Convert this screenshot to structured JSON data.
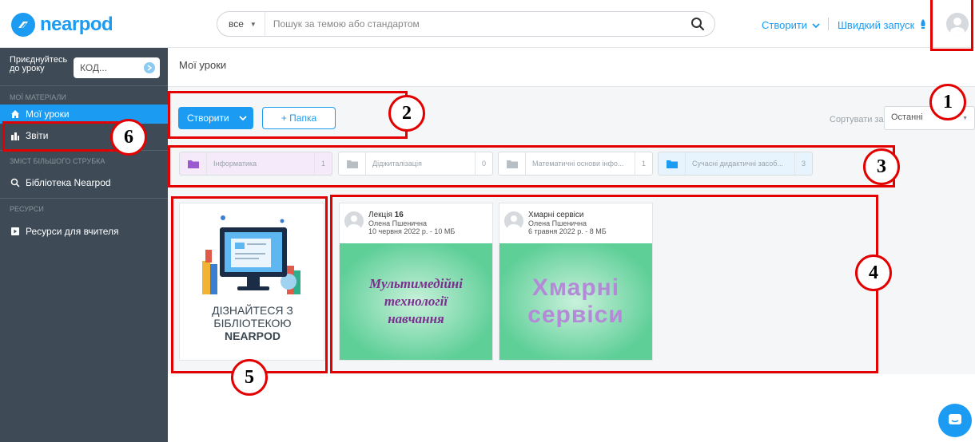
{
  "brand": {
    "name": "nearpod",
    "color": "#1b9cf2"
  },
  "search": {
    "scope": "все",
    "placeholder": "Пошук за темою або стандартом"
  },
  "header": {
    "create": "Створити",
    "quick_launch": "Швидкий запуск"
  },
  "sidebar": {
    "join_label": "Приєднуйтесь до уроку",
    "join_placeholder": "КОД...",
    "section_my": "МОЇ МАТЕРІАЛИ",
    "item_lessons": "Мої уроки",
    "item_reports": "Звіти",
    "section_content": "ЗМІСТ БІЛЬШОГО СТРУБКА",
    "item_library": "Бібліотека Nearpod",
    "section_resources": "РЕСУРСИ",
    "item_resources": "Ресурси для вчителя"
  },
  "main": {
    "title": "Мої уроки",
    "create_button": "Створити",
    "folder_button": "+ Папка",
    "sort_label": "Сортувати за:",
    "sort_value": "Останні"
  },
  "folders": [
    {
      "name": "Інформатика",
      "count": "1",
      "color": "#9b59d0",
      "bg": "#f4eafa"
    },
    {
      "name": "Діджиталізація",
      "count": "0",
      "color": "#b7bec4",
      "bg": "#ffffff"
    },
    {
      "name": "Математичні основи інфо...",
      "count": "1",
      "color": "#b7bec4",
      "bg": "#ffffff"
    },
    {
      "name": "Сучасні дидактичні засоб...",
      "count": "3",
      "color": "#1b9cf2",
      "bg": "#e8f4fd"
    }
  ],
  "promo": {
    "line1": "ДІЗНАЙТЕСЯ З",
    "line2": "БІБЛІОТЕКОЮ",
    "line3": "NEARPOD"
  },
  "cards": [
    {
      "title_prefix": "Лекція ",
      "title_number": "16",
      "author": "Олена Пшенична",
      "meta": "10 червня 2022 р. - 10 МБ",
      "thumb_line1": "Мультимедійні",
      "thumb_line2": "технології",
      "thumb_line3": "навчання"
    },
    {
      "title": "Хмарні сервіси",
      "author": "Олена Пшенична",
      "meta": "6 травня 2022 р. - 8 МБ",
      "thumb_line1": "Хмарні",
      "thumb_line2": "сервіси"
    }
  ],
  "annotations": [
    "1",
    "2",
    "3",
    "4",
    "5",
    "6"
  ],
  "annotation_color": "#e30000"
}
